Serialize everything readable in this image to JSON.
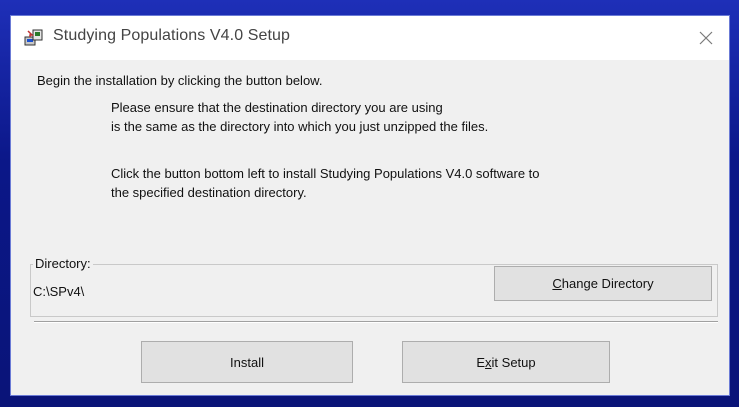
{
  "window": {
    "title": "Studying Populations V4.0 Setup",
    "close_glyph": "×"
  },
  "content": {
    "intro": "Begin the installation by clicking the button below.",
    "para1_line1": "Please ensure that the destination directory you are using",
    "para1_line2": "is the same as the directory into which you just unzipped the files.",
    "para2_line1": "Click the button bottom left to install Studying Populations V4.0 software to",
    "para2_line2": "the specified destination directory."
  },
  "directory": {
    "label": "Directory:",
    "value": "C:\\SPv4\\",
    "change_button": {
      "mnemonic": "C",
      "rest": "hange Directory"
    }
  },
  "buttons": {
    "install": "Install",
    "exit": {
      "before": "E",
      "mnemonic": "x",
      "after": "it Setup"
    }
  },
  "colors": {
    "desktop": "#0b1788",
    "dialog_bg": "#f0f0f0",
    "button_bg": "#e1e1e1"
  },
  "icons": {
    "app": "setup-computer-icon",
    "close": "close-icon"
  }
}
